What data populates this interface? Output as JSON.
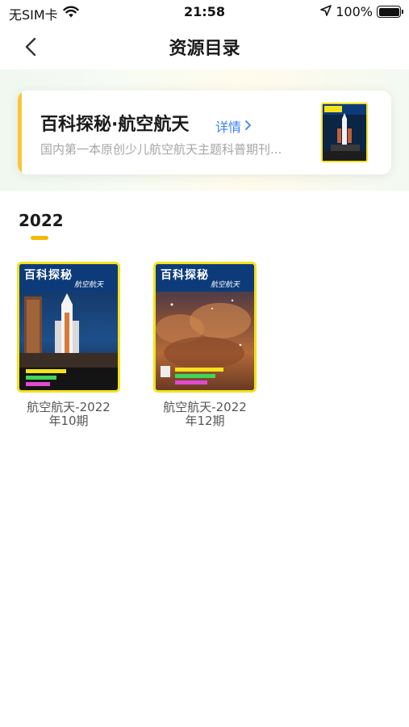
{
  "status": {
    "carrier": "无SIM卡",
    "time": "21:58",
    "battery": "100%"
  },
  "nav": {
    "title": "资源目录"
  },
  "magazine": {
    "title": "百科探秘·航空航天",
    "detail_label": "详情",
    "description": "国内第一本原创少儿航空航天主题科普期刊..."
  },
  "year_tab": "2022",
  "issues": [
    {
      "label_line1": "航空航天-2022",
      "label_line2": "年10期",
      "cover_brand": "百科探秘",
      "cover_subtitle": "航空航天"
    },
    {
      "label_line1": "航空航天-2022",
      "label_line2": "年12期",
      "cover_brand": "百科探秘",
      "cover_subtitle": "航空航天"
    }
  ],
  "colors": {
    "accent_yellow": "#f7c738",
    "link_blue": "#3b82f6",
    "cover_border": "#f3e21d"
  }
}
